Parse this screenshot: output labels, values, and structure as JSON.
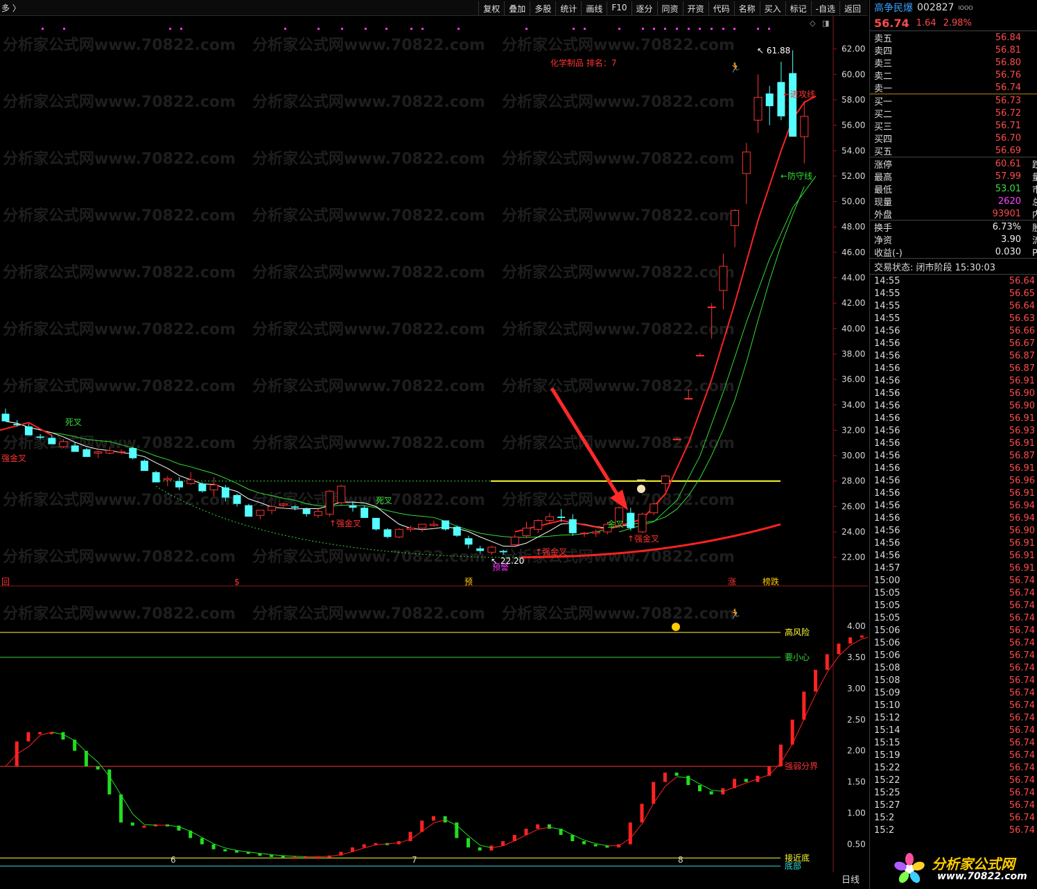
{
  "topbar": {
    "left_text": "多 〉",
    "buttons": [
      "复权",
      "叠加",
      "多股",
      "统计",
      "画线",
      "F10",
      "逐分",
      "同资",
      "开资",
      "代码",
      "名称",
      "买入",
      "标记",
      "-自选",
      "返回"
    ]
  },
  "stock": {
    "name": "高争民爆",
    "code": "002827",
    "sup": "lOOO",
    "price": "56.74",
    "change": "1.64",
    "pct": "2.98%"
  },
  "asks": [
    {
      "label": "卖五",
      "price": "56.84"
    },
    {
      "label": "卖四",
      "price": "56.81"
    },
    {
      "label": "卖三",
      "price": "56.80"
    },
    {
      "label": "卖二",
      "price": "56.76"
    },
    {
      "label": "卖一",
      "price": "56.74"
    }
  ],
  "bids": [
    {
      "label": "买一",
      "price": "56.73"
    },
    {
      "label": "买二",
      "price": "56.72"
    },
    {
      "label": "买三",
      "price": "56.71"
    },
    {
      "label": "买四",
      "price": "56.70"
    },
    {
      "label": "买五",
      "price": "56.69"
    }
  ],
  "stats1": [
    {
      "label": "涨停",
      "value": "60.61",
      "color": "red",
      "right": "跌停"
    },
    {
      "label": "最高",
      "value": "57.99",
      "color": "red",
      "right": "量比"
    },
    {
      "label": "最低",
      "value": "53.01",
      "color": "green",
      "right": "市值"
    },
    {
      "label": "现量",
      "value": "2620",
      "color": "mag",
      "right": "总量"
    },
    {
      "label": "外盘",
      "value": "93901",
      "color": "red",
      "right": "内盘"
    }
  ],
  "stats2": [
    {
      "label": "换手",
      "value": "6.73%",
      "color": "white",
      "right": "股本"
    },
    {
      "label": "净资",
      "value": "3.90",
      "color": "white",
      "right": "流通"
    },
    {
      "label": "收益(-)",
      "value": "0.030",
      "color": "white",
      "right": "PE(动"
    }
  ],
  "trade_status": "交易状态: 闭市阶段 15:30:03",
  "ticks": [
    [
      "14:55",
      "56.64"
    ],
    [
      "14:55",
      "56.65"
    ],
    [
      "14:55",
      "56.64"
    ],
    [
      "14:55",
      "56.63"
    ],
    [
      "14:56",
      "56.66"
    ],
    [
      "14:56",
      "56.67"
    ],
    [
      "14:56",
      "56.87"
    ],
    [
      "14:56",
      "56.87"
    ],
    [
      "14:56",
      "56.91"
    ],
    [
      "14:56",
      "56.90"
    ],
    [
      "14:56",
      "56.90"
    ],
    [
      "14:56",
      "56.91"
    ],
    [
      "14:56",
      "56.93"
    ],
    [
      "14:56",
      "56.91"
    ],
    [
      "14:56",
      "56.87"
    ],
    [
      "14:56",
      "56.91"
    ],
    [
      "14:56",
      "56.96"
    ],
    [
      "14:56",
      "56.91"
    ],
    [
      "14:56",
      "56.94"
    ],
    [
      "14:56",
      "56.94"
    ],
    [
      "14:56",
      "56.90"
    ],
    [
      "14:56",
      "56.91"
    ],
    [
      "14:56",
      "56.91"
    ],
    [
      "14:57",
      "56.91"
    ],
    [
      "15:00",
      "56.74"
    ],
    [
      "15:05",
      "56.74"
    ],
    [
      "15:05",
      "56.74"
    ],
    [
      "15:05",
      "56.74"
    ],
    [
      "15:06",
      "56.74"
    ],
    [
      "15:06",
      "56.74"
    ],
    [
      "15:06",
      "56.74"
    ],
    [
      "15:08",
      "56.74"
    ],
    [
      "15:08",
      "56.74"
    ],
    [
      "15:09",
      "56.74"
    ],
    [
      "15:10",
      "56.74"
    ],
    [
      "15:12",
      "56.74"
    ],
    [
      "15:14",
      "56.74"
    ],
    [
      "15:15",
      "56.74"
    ],
    [
      "15:19",
      "56.74"
    ],
    [
      "15:22",
      "56.74"
    ],
    [
      "15:22",
      "56.74"
    ],
    [
      "15:25",
      "56.74"
    ],
    [
      "15:27",
      "56.74"
    ],
    [
      "15:2",
      "56.74"
    ],
    [
      "15:2",
      "56.74"
    ]
  ],
  "watermark": "分析家公式网www.70822.com",
  "logo": {
    "text": "分析家公式网",
    "url": "www.70822.com"
  },
  "period_label": "日线",
  "colors": {
    "up": "#ff3333",
    "down": "#54ffff",
    "ma_white": "#ffffff",
    "ma_green": "#33dd33",
    "yellow": "#ffff33"
  },
  "chart_data": [
    {
      "type": "candlestick",
      "title": "化学制品 排名：7",
      "ylim": [
        21.0,
        64.0
      ],
      "y_ticks": [
        "62.00",
        "60.00",
        "58.00",
        "56.00",
        "54.00",
        "52.00",
        "50.00",
        "48.00",
        "46.00",
        "44.00",
        "42.00",
        "40.00",
        "38.00",
        "36.00",
        "34.00",
        "32.00",
        "30.00",
        "28.00",
        "26.00",
        "24.00",
        "22.00"
      ],
      "x_ticks": [
        "6",
        "7",
        "8"
      ],
      "candles": [
        {
          "o": 33.3,
          "h": 33.7,
          "l": 32.7,
          "c": 32.7
        },
        {
          "o": 32.5,
          "h": 32.8,
          "l": 32.3,
          "c": 32.4
        },
        {
          "o": 32.3,
          "h": 32.5,
          "l": 31.6,
          "c": 31.6
        },
        {
          "o": 31.5,
          "h": 31.7,
          "l": 31.3,
          "c": 31.4
        },
        {
          "o": 31.4,
          "h": 31.6,
          "l": 30.9,
          "c": 30.9
        },
        {
          "o": 30.7,
          "h": 31.3,
          "l": 30.6,
          "c": 31.1
        },
        {
          "o": 30.8,
          "h": 31.1,
          "l": 30.3,
          "c": 30.3
        },
        {
          "o": 30.5,
          "h": 30.6,
          "l": 29.9,
          "c": 29.9
        },
        {
          "o": 30.2,
          "h": 30.4,
          "l": 29.8,
          "c": 30.3
        },
        {
          "o": 30.2,
          "h": 30.7,
          "l": 30.1,
          "c": 30.4
        },
        {
          "o": 30.3,
          "h": 30.5,
          "l": 30.1,
          "c": 30.3
        },
        {
          "o": 30.6,
          "h": 30.7,
          "l": 29.7,
          "c": 29.8
        },
        {
          "o": 29.6,
          "h": 29.7,
          "l": 28.8,
          "c": 28.8
        },
        {
          "o": 28.7,
          "h": 28.8,
          "l": 27.9,
          "c": 27.9
        },
        {
          "o": 28.1,
          "h": 28.4,
          "l": 27.6,
          "c": 28.2
        },
        {
          "o": 28.0,
          "h": 28.3,
          "l": 27.3,
          "c": 27.5
        },
        {
          "o": 27.8,
          "h": 28.7,
          "l": 27.7,
          "c": 28.1
        },
        {
          "o": 27.8,
          "h": 27.9,
          "l": 27.1,
          "c": 27.2
        },
        {
          "o": 27.3,
          "h": 28.3,
          "l": 26.8,
          "c": 27.7
        },
        {
          "o": 27.5,
          "h": 27.7,
          "l": 26.4,
          "c": 26.7
        },
        {
          "o": 26.9,
          "h": 27.0,
          "l": 26.0,
          "c": 26.2
        },
        {
          "o": 26.1,
          "h": 26.2,
          "l": 25.2,
          "c": 25.2
        },
        {
          "o": 25.3,
          "h": 25.7,
          "l": 25.0,
          "c": 25.7
        },
        {
          "o": 25.7,
          "h": 26.1,
          "l": 25.4,
          "c": 26.0
        },
        {
          "o": 26.1,
          "h": 26.3,
          "l": 25.8,
          "c": 26.2
        },
        {
          "o": 26.0,
          "h": 26.1,
          "l": 25.7,
          "c": 25.9
        },
        {
          "o": 25.8,
          "h": 25.9,
          "l": 25.2,
          "c": 25.4
        },
        {
          "o": 25.3,
          "h": 25.8,
          "l": 25.1,
          "c": 25.6
        },
        {
          "o": 25.4,
          "h": 27.3,
          "l": 25.2,
          "c": 27.2
        },
        {
          "o": 26.3,
          "h": 27.7,
          "l": 26.2,
          "c": 27.6
        },
        {
          "o": 26.1,
          "h": 26.4,
          "l": 25.6,
          "c": 25.9
        },
        {
          "o": 25.9,
          "h": 26.1,
          "l": 25.1,
          "c": 25.1
        },
        {
          "o": 25.1,
          "h": 25.1,
          "l": 24.1,
          "c": 24.2
        },
        {
          "o": 24.2,
          "h": 24.3,
          "l": 23.5,
          "c": 23.6
        },
        {
          "o": 23.6,
          "h": 24.3,
          "l": 23.5,
          "c": 24.2
        },
        {
          "o": 24.2,
          "h": 24.5,
          "l": 24.0,
          "c": 24.3
        },
        {
          "o": 24.3,
          "h": 24.6,
          "l": 24.0,
          "c": 24.6
        },
        {
          "o": 24.5,
          "h": 24.9,
          "l": 24.4,
          "c": 24.6
        },
        {
          "o": 24.9,
          "h": 24.9,
          "l": 24.1,
          "c": 24.2
        },
        {
          "o": 24.4,
          "h": 24.5,
          "l": 23.6,
          "c": 23.7
        },
        {
          "o": 23.5,
          "h": 23.7,
          "l": 22.7,
          "c": 23.0
        },
        {
          "o": 22.7,
          "h": 22.9,
          "l": 22.3,
          "c": 22.5
        },
        {
          "o": 22.4,
          "h": 22.9,
          "l": 22.2,
          "c": 22.8
        },
        {
          "o": 22.5,
          "h": 22.6,
          "l": 22.2,
          "c": 22.4
        },
        {
          "o": 23.0,
          "h": 23.8,
          "l": 22.8,
          "c": 23.6
        },
        {
          "o": 23.7,
          "h": 24.8,
          "l": 23.5,
          "c": 24.3
        },
        {
          "o": 24.2,
          "h": 25.0,
          "l": 23.9,
          "c": 24.9
        },
        {
          "o": 24.9,
          "h": 25.5,
          "l": 24.6,
          "c": 25.2
        },
        {
          "o": 25.2,
          "h": 25.8,
          "l": 24.8,
          "c": 25.1
        },
        {
          "o": 25.0,
          "h": 25.4,
          "l": 23.7,
          "c": 23.9
        },
        {
          "o": 23.9,
          "h": 24.0,
          "l": 23.6,
          "c": 23.9
        },
        {
          "o": 23.9,
          "h": 24.2,
          "l": 23.6,
          "c": 24.0
        },
        {
          "o": 24.0,
          "h": 24.8,
          "l": 23.8,
          "c": 24.6
        },
        {
          "o": 24.5,
          "h": 26.0,
          "l": 24.3,
          "c": 25.9
        },
        {
          "o": 25.5,
          "h": 25.9,
          "l": 24.1,
          "c": 24.3
        },
        {
          "o": 24.0,
          "h": 25.5,
          "l": 23.9,
          "c": 25.4
        },
        {
          "o": 25.5,
          "h": 26.3,
          "l": 25.3,
          "c": 26.2
        },
        {
          "o": 27.8,
          "h": 28.5,
          "l": 27.2,
          "c": 28.4
        },
        {
          "o": 31.3,
          "h": 31.4,
          "l": 31.2,
          "c": 31.3
        },
        {
          "o": 34.5,
          "h": 35.2,
          "l": 34.4,
          "c": 34.5
        },
        {
          "o": 37.9,
          "h": 38.1,
          "l": 37.8,
          "c": 37.9
        },
        {
          "o": 41.7,
          "h": 42.0,
          "l": 39.2,
          "c": 41.7
        },
        {
          "o": 43.0,
          "h": 45.9,
          "l": 41.5,
          "c": 44.9
        },
        {
          "o": 48.1,
          "h": 49.4,
          "l": 46.4,
          "c": 49.3
        },
        {
          "o": 52.2,
          "h": 54.6,
          "l": 49.8,
          "c": 53.9
        },
        {
          "o": 56.4,
          "h": 60.0,
          "l": 55.4,
          "c": 58.2
        },
        {
          "o": 58.5,
          "h": 59.1,
          "l": 56.0,
          "c": 57.5
        },
        {
          "o": 59.4,
          "h": 61.0,
          "l": 56.4,
          "c": 56.7
        },
        {
          "o": 60.1,
          "h": 61.9,
          "l": 55.1,
          "c": 55.1
        },
        {
          "o": 55.1,
          "h": 57.9,
          "l": 53.0,
          "c": 56.7
        }
      ],
      "annotations": [
        "死叉",
        "强金叉",
        "死叉",
        "强金叉",
        "强金叉",
        "强金叉",
        "金叉",
        "预警",
        "进攻线",
        "防守线",
        "61.88",
        "22.20"
      ],
      "max_label": "61.88",
      "min_label": "22.20",
      "markers": [
        "回",
        "$",
        "预",
        "涨",
        "榜跌"
      ]
    },
    {
      "type": "bar",
      "y_ticks": [
        "4.00",
        "3.50",
        "3.00",
        "2.50",
        "2.00",
        "1.50",
        "1.00",
        "0.50"
      ],
      "ylim": [
        0.25,
        4.4
      ],
      "levels": [
        {
          "name": "高风险",
          "value": 3.9,
          "color": "#ffff33"
        },
        {
          "name": "要小心",
          "value": 3.5,
          "color": "#33dd33"
        },
        {
          "name": "强弱分界",
          "value": 1.75,
          "color": "#ff3333"
        },
        {
          "name": "接近底",
          "value": 0.28,
          "color": "#ffff33"
        },
        {
          "name": "底部",
          "value": 0.15,
          "color": "#33dddd"
        }
      ],
      "values": [
        1.75,
        2.15,
        2.3,
        2.3,
        2.3,
        2.18,
        2.0,
        1.75,
        1.7,
        1.3,
        0.85,
        0.8,
        0.8,
        0.82,
        0.8,
        0.72,
        0.6,
        0.5,
        0.42,
        0.4,
        0.38,
        0.35,
        0.33,
        0.32,
        0.3,
        0.3,
        0.3,
        0.3,
        0.32,
        0.38,
        0.45,
        0.5,
        0.52,
        0.5,
        0.55,
        0.7,
        0.88,
        0.95,
        0.85,
        0.6,
        0.45,
        0.4,
        0.48,
        0.55,
        0.65,
        0.75,
        0.82,
        0.75,
        0.65,
        0.55,
        0.5,
        0.48,
        0.45,
        0.5,
        0.85,
        1.15,
        1.5,
        1.65,
        1.6,
        1.45,
        1.35,
        1.3,
        1.4,
        1.55,
        1.5,
        1.6,
        1.75,
        2.1,
        2.5,
        2.95,
        3.3,
        3.55,
        3.72,
        3.82,
        3.85,
        3.87,
        3.88,
        3.9,
        3.92,
        3.9,
        3.92,
        3.88,
        3.6
      ],
      "x_ticks": [
        "6",
        "7",
        "8"
      ]
    }
  ]
}
